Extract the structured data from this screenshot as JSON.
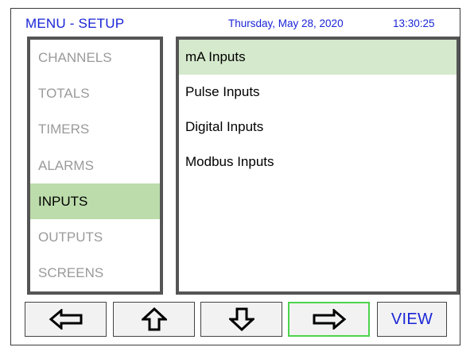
{
  "header": {
    "title": "MENU - SETUP",
    "date": "Thursday, May 28, 2020",
    "time": "13:30:25"
  },
  "menu": {
    "items": [
      {
        "label": "CHANNELS",
        "active": false
      },
      {
        "label": "TOTALS",
        "active": false
      },
      {
        "label": "TIMERS",
        "active": false
      },
      {
        "label": "ALARMS",
        "active": false
      },
      {
        "label": "INPUTS",
        "active": true
      },
      {
        "label": "OUTPUTS",
        "active": false
      },
      {
        "label": "SCREENS",
        "active": false
      }
    ]
  },
  "submenu": {
    "items": [
      {
        "label": "mA Inputs",
        "active": true
      },
      {
        "label": "Pulse Inputs",
        "active": false
      },
      {
        "label": "Digital Inputs",
        "active": false
      },
      {
        "label": "Modbus Inputs",
        "active": false
      }
    ]
  },
  "buttons": {
    "left_icon": "arrow-left-icon",
    "up_icon": "arrow-up-icon",
    "down_icon": "arrow-down-icon",
    "right_icon": "arrow-right-icon",
    "view_label": "VIEW"
  },
  "colors": {
    "accent_text": "#1a25d6",
    "menu_active_bg": "#bcdcab",
    "submenu_active_bg": "#d5e9cc",
    "selected_button_border": "#4cd44c"
  }
}
